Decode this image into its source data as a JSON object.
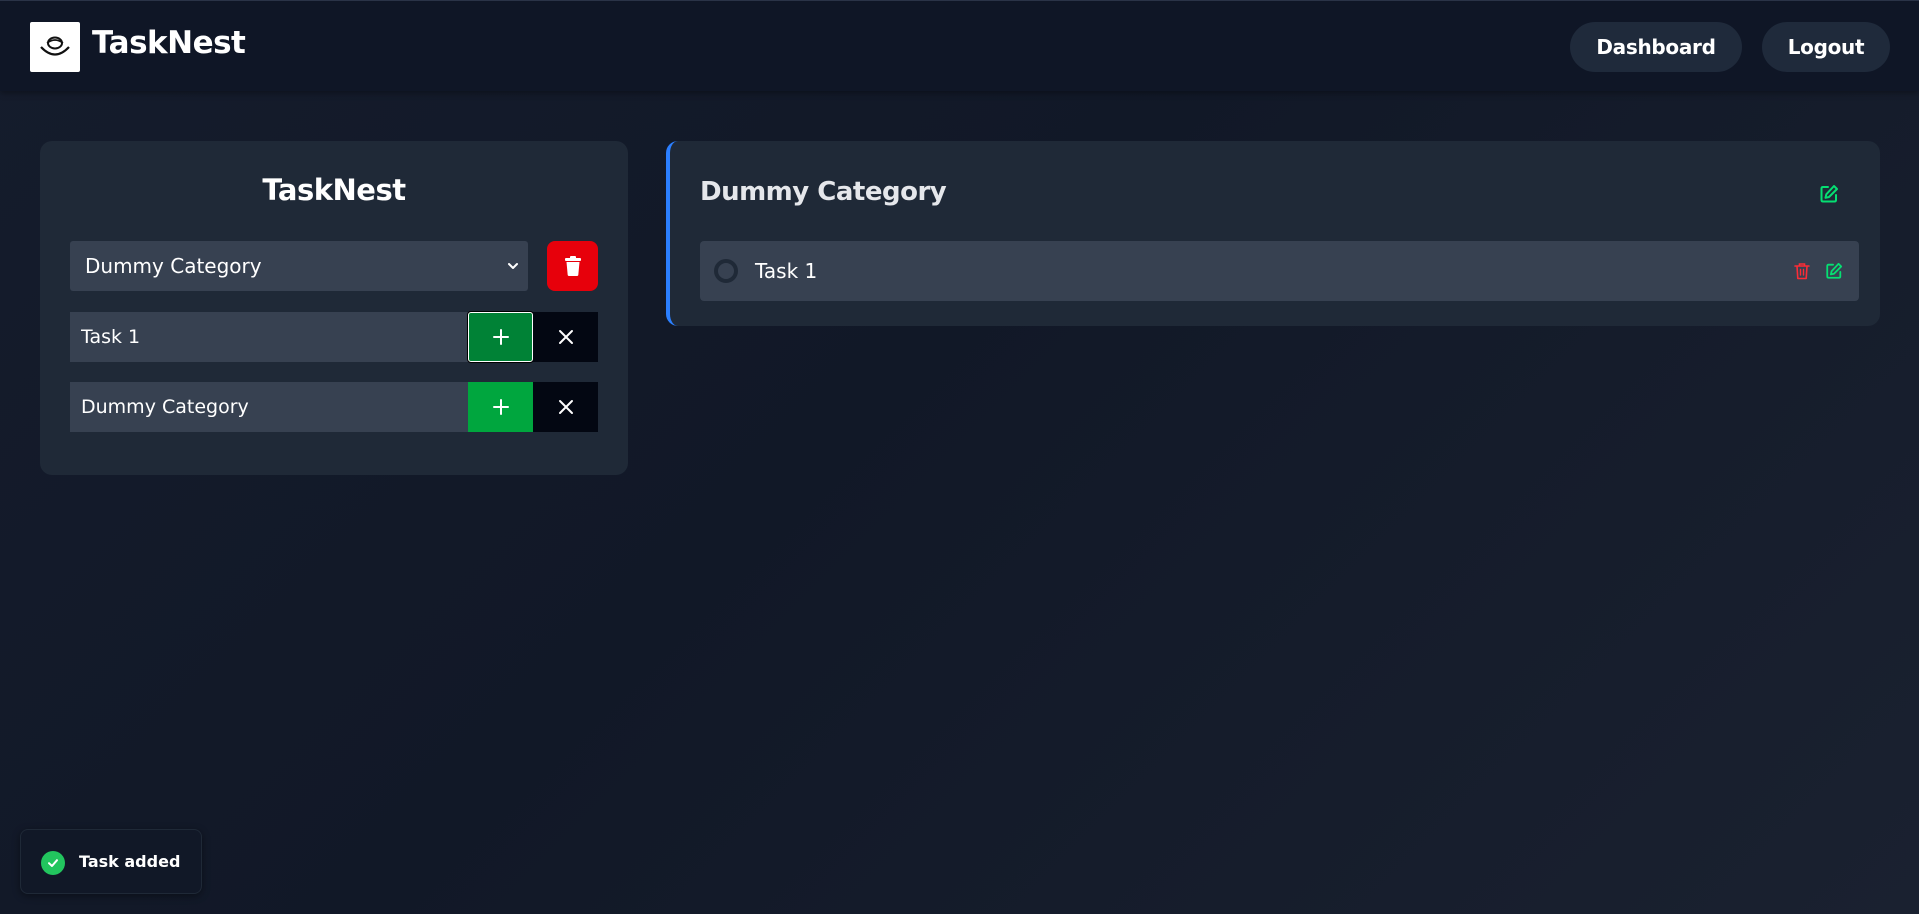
{
  "header": {
    "brand": "TaskNest",
    "nav": {
      "dashboard_label": "Dashboard",
      "logout_label": "Logout"
    }
  },
  "sidebar": {
    "title": "TaskNest",
    "category_select": {
      "selected": "Dummy Category"
    },
    "task_input": {
      "value": "Task 1"
    },
    "category_input": {
      "value": "Dummy Category"
    }
  },
  "category": {
    "name": "Dummy Category",
    "tasks": [
      {
        "label": "Task 1",
        "done": false
      }
    ]
  },
  "toast": {
    "message": "Task added"
  },
  "icons": {
    "logo": "nest-logo-icon",
    "delete": "trash-icon",
    "add": "plus-icon",
    "clear": "close-icon",
    "edit": "edit-icon",
    "toast": "check-circle-icon",
    "select": "chevron-down-icon"
  },
  "colors": {
    "accent_blue": "#2b7fff",
    "add_green": "#00a63e",
    "delete_red": "#e7000b",
    "edit_green": "#05df72",
    "task_delete_red": "#fb2c36",
    "toast_green": "#22c55e"
  }
}
